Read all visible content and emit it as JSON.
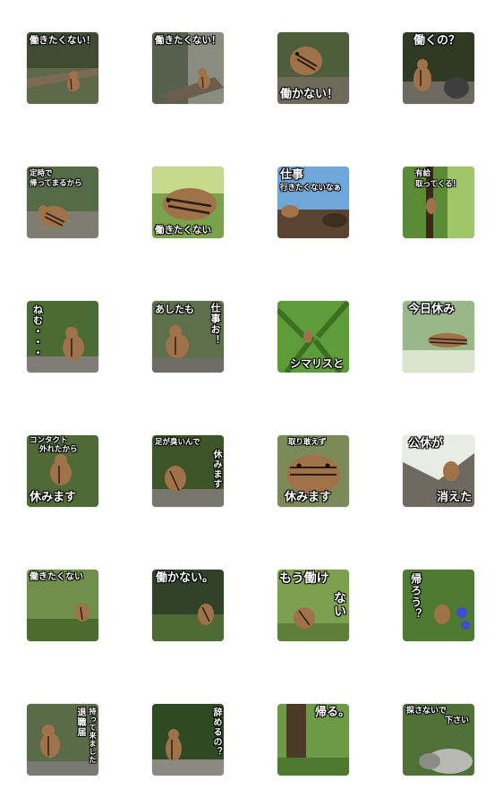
{
  "stickers": [
    {
      "caption": "働きたくない！"
    },
    {
      "caption": "働きたくない！"
    },
    {
      "caption": "働かない！"
    },
    {
      "caption": "働くの？"
    },
    {
      "caption_line1": "定時で",
      "caption_line2": "帰ってまるから"
    },
    {
      "caption": "働きたくない"
    },
    {
      "caption_line1": "仕事",
      "caption_line2": "行きたくないなぁ"
    },
    {
      "caption_line1": "有給",
      "caption_line2": "取ってくる！"
    },
    {
      "caption": "ねむ・・・"
    },
    {
      "caption_line1": "あしたも",
      "caption_line2": "仕事お！"
    },
    {
      "caption": "シマリスと"
    },
    {
      "caption": "今日休み"
    },
    {
      "caption_line1": "コンタクト",
      "caption_line2": "外れたから",
      "caption_line3": "休みます"
    },
    {
      "caption_line1": "足が臭いんで",
      "caption_line2": "休みます"
    },
    {
      "caption_line1": "取り敢えず",
      "caption_line2": "休みます"
    },
    {
      "caption_line1": "公休が",
      "caption_line2": "消えた"
    },
    {
      "caption": "働きたくない"
    },
    {
      "caption": "働かない。"
    },
    {
      "caption_line1": "もう働け",
      "caption_line2": "ない"
    },
    {
      "caption": "帰ろう？"
    },
    {
      "caption_line1": "退職届",
      "caption_line2": "持って来ました"
    },
    {
      "caption": "辞めるの？"
    },
    {
      "caption": "帰る。"
    },
    {
      "caption_line1": "探さないで",
      "caption_line2": "下さい"
    }
  ],
  "colors": {
    "forest_dark": "#2f3a24",
    "forest_mid": "#4f6b34",
    "leaf_green": "#6fae3a",
    "sky_blue": "#6fa7d8",
    "chipmunk_brown": "#a0724a",
    "stripe_dark": "#2a1d14",
    "rock_gray": "#8a8a84",
    "flower_blue": "#3b4fd0"
  }
}
